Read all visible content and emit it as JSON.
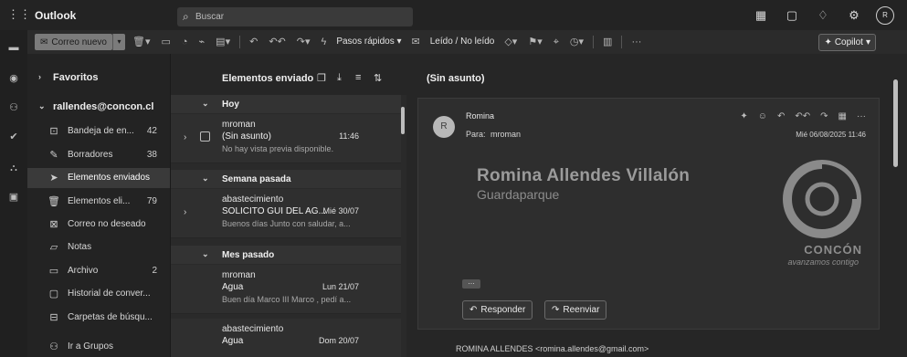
{
  "topbar": {
    "app_title": "Outlook",
    "search_placeholder": "Buscar",
    "icons": [
      "grid-icon",
      "chat-icon",
      "bell-icon",
      "gear-icon"
    ],
    "avatar_initial": "R"
  },
  "ribbon": {
    "new_mail_label": "Correo nuevo",
    "quick_steps_label": "Pasos rápidos",
    "read_unread_label": "Leído / No leído",
    "copilot_label": "Copilot"
  },
  "folders": {
    "favorites_label": "Favoritos",
    "account_label": "rallendes@concon.cl",
    "items": [
      {
        "label": "Bandeja de en...",
        "count": "42"
      },
      {
        "label": "Borradores",
        "count": "38"
      },
      {
        "label": "Elementos enviados",
        "count": ""
      },
      {
        "label": "Elementos eli...",
        "count": "79"
      },
      {
        "label": "Correo no deseado",
        "count": ""
      },
      {
        "label": "Notas",
        "count": ""
      },
      {
        "label": "Archivo",
        "count": "2"
      },
      {
        "label": "Historial de conver...",
        "count": ""
      },
      {
        "label": "Carpetas de búsqu...",
        "count": ""
      },
      {
        "label": "Ir a Grupos",
        "count": ""
      }
    ]
  },
  "list": {
    "title": "Elementos enviado",
    "groups": [
      "Hoy",
      "Semana pasada",
      "Mes pasado"
    ],
    "messages": [
      {
        "from": "mroman",
        "subject": "(Sin asunto)",
        "date": "11:46",
        "preview": "No hay vista previa disponible."
      },
      {
        "from": "abastecimiento",
        "subject": "SOLICITO GUI DEL AG...",
        "date": "Mié 30/07",
        "preview": "Buenos días Junto con saludar, a..."
      },
      {
        "from": "mroman",
        "subject": "Agua",
        "date": "Lun 21/07",
        "preview": "Buen día Marco III Marco , pedí a..."
      },
      {
        "from": "abastecimiento",
        "subject": "Agua",
        "date": "Dom 20/07",
        "preview": ""
      }
    ]
  },
  "reading": {
    "subject": "(Sin asunto)",
    "sender": "Romina",
    "avatar_initial": "R",
    "to_label": "Para:",
    "to_value": "mroman",
    "date": "Mié 06/08/2025 11:46",
    "signature_name": "Romina Allendes Villalón",
    "signature_role": "Guardaparque",
    "logo_text": "CONCÓN",
    "logo_tagline": "avanzamos contigo",
    "reply_label": "Responder",
    "forward_label": "Reenviar",
    "second_sender": "ROMINA ALLENDES <romina.allendes@gmail.com>"
  }
}
